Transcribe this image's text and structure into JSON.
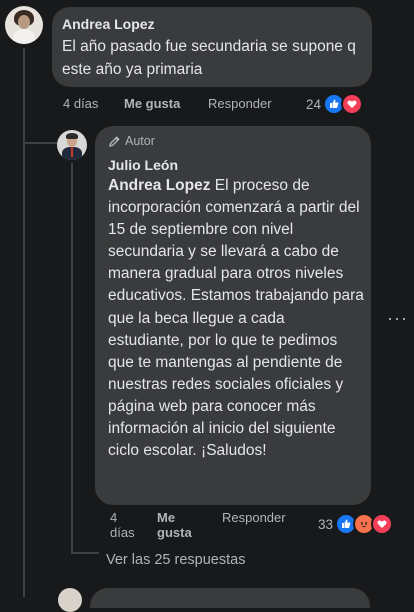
{
  "comment1": {
    "author": "Andrea Lopez",
    "text": "El año pasado fue secundaria se supone q este año ya primaria",
    "time": "4 días",
    "like_label": "Me gusta",
    "reply_label": "Responder",
    "reaction_count": "24",
    "reactions": [
      "like-icon",
      "love-icon"
    ]
  },
  "reply1": {
    "badge": "Autor",
    "author": "Julio León",
    "mention": "Andrea Lopez",
    "text": " El proceso de incorporación comenzará a partir del 15 de septiembre con nivel secundaria y se llevará a cabo de manera gradual para otros niveles educativos. Estamos trabajando para que la beca llegue a cada estudiante, por lo que te pedimos que te mantengas al pendiente de nuestras redes sociales oficiales y página web para conocer más información al inicio del siguiente ciclo escolar. ¡Saludos!",
    "time_line1": "4",
    "time_line2": "días",
    "like_line1": "Me",
    "like_line2": "gusta",
    "reply_label": "Responder",
    "reaction_count": "33",
    "reactions": [
      "like-icon",
      "angry-icon",
      "love-icon"
    ]
  },
  "view_replies": "Ver las 25 respuestas",
  "colors": {
    "background": "#18191a",
    "bubble": "#3a3b3c",
    "like": "#1877f2",
    "love": "#f33e58",
    "angry": "#f7714c"
  }
}
